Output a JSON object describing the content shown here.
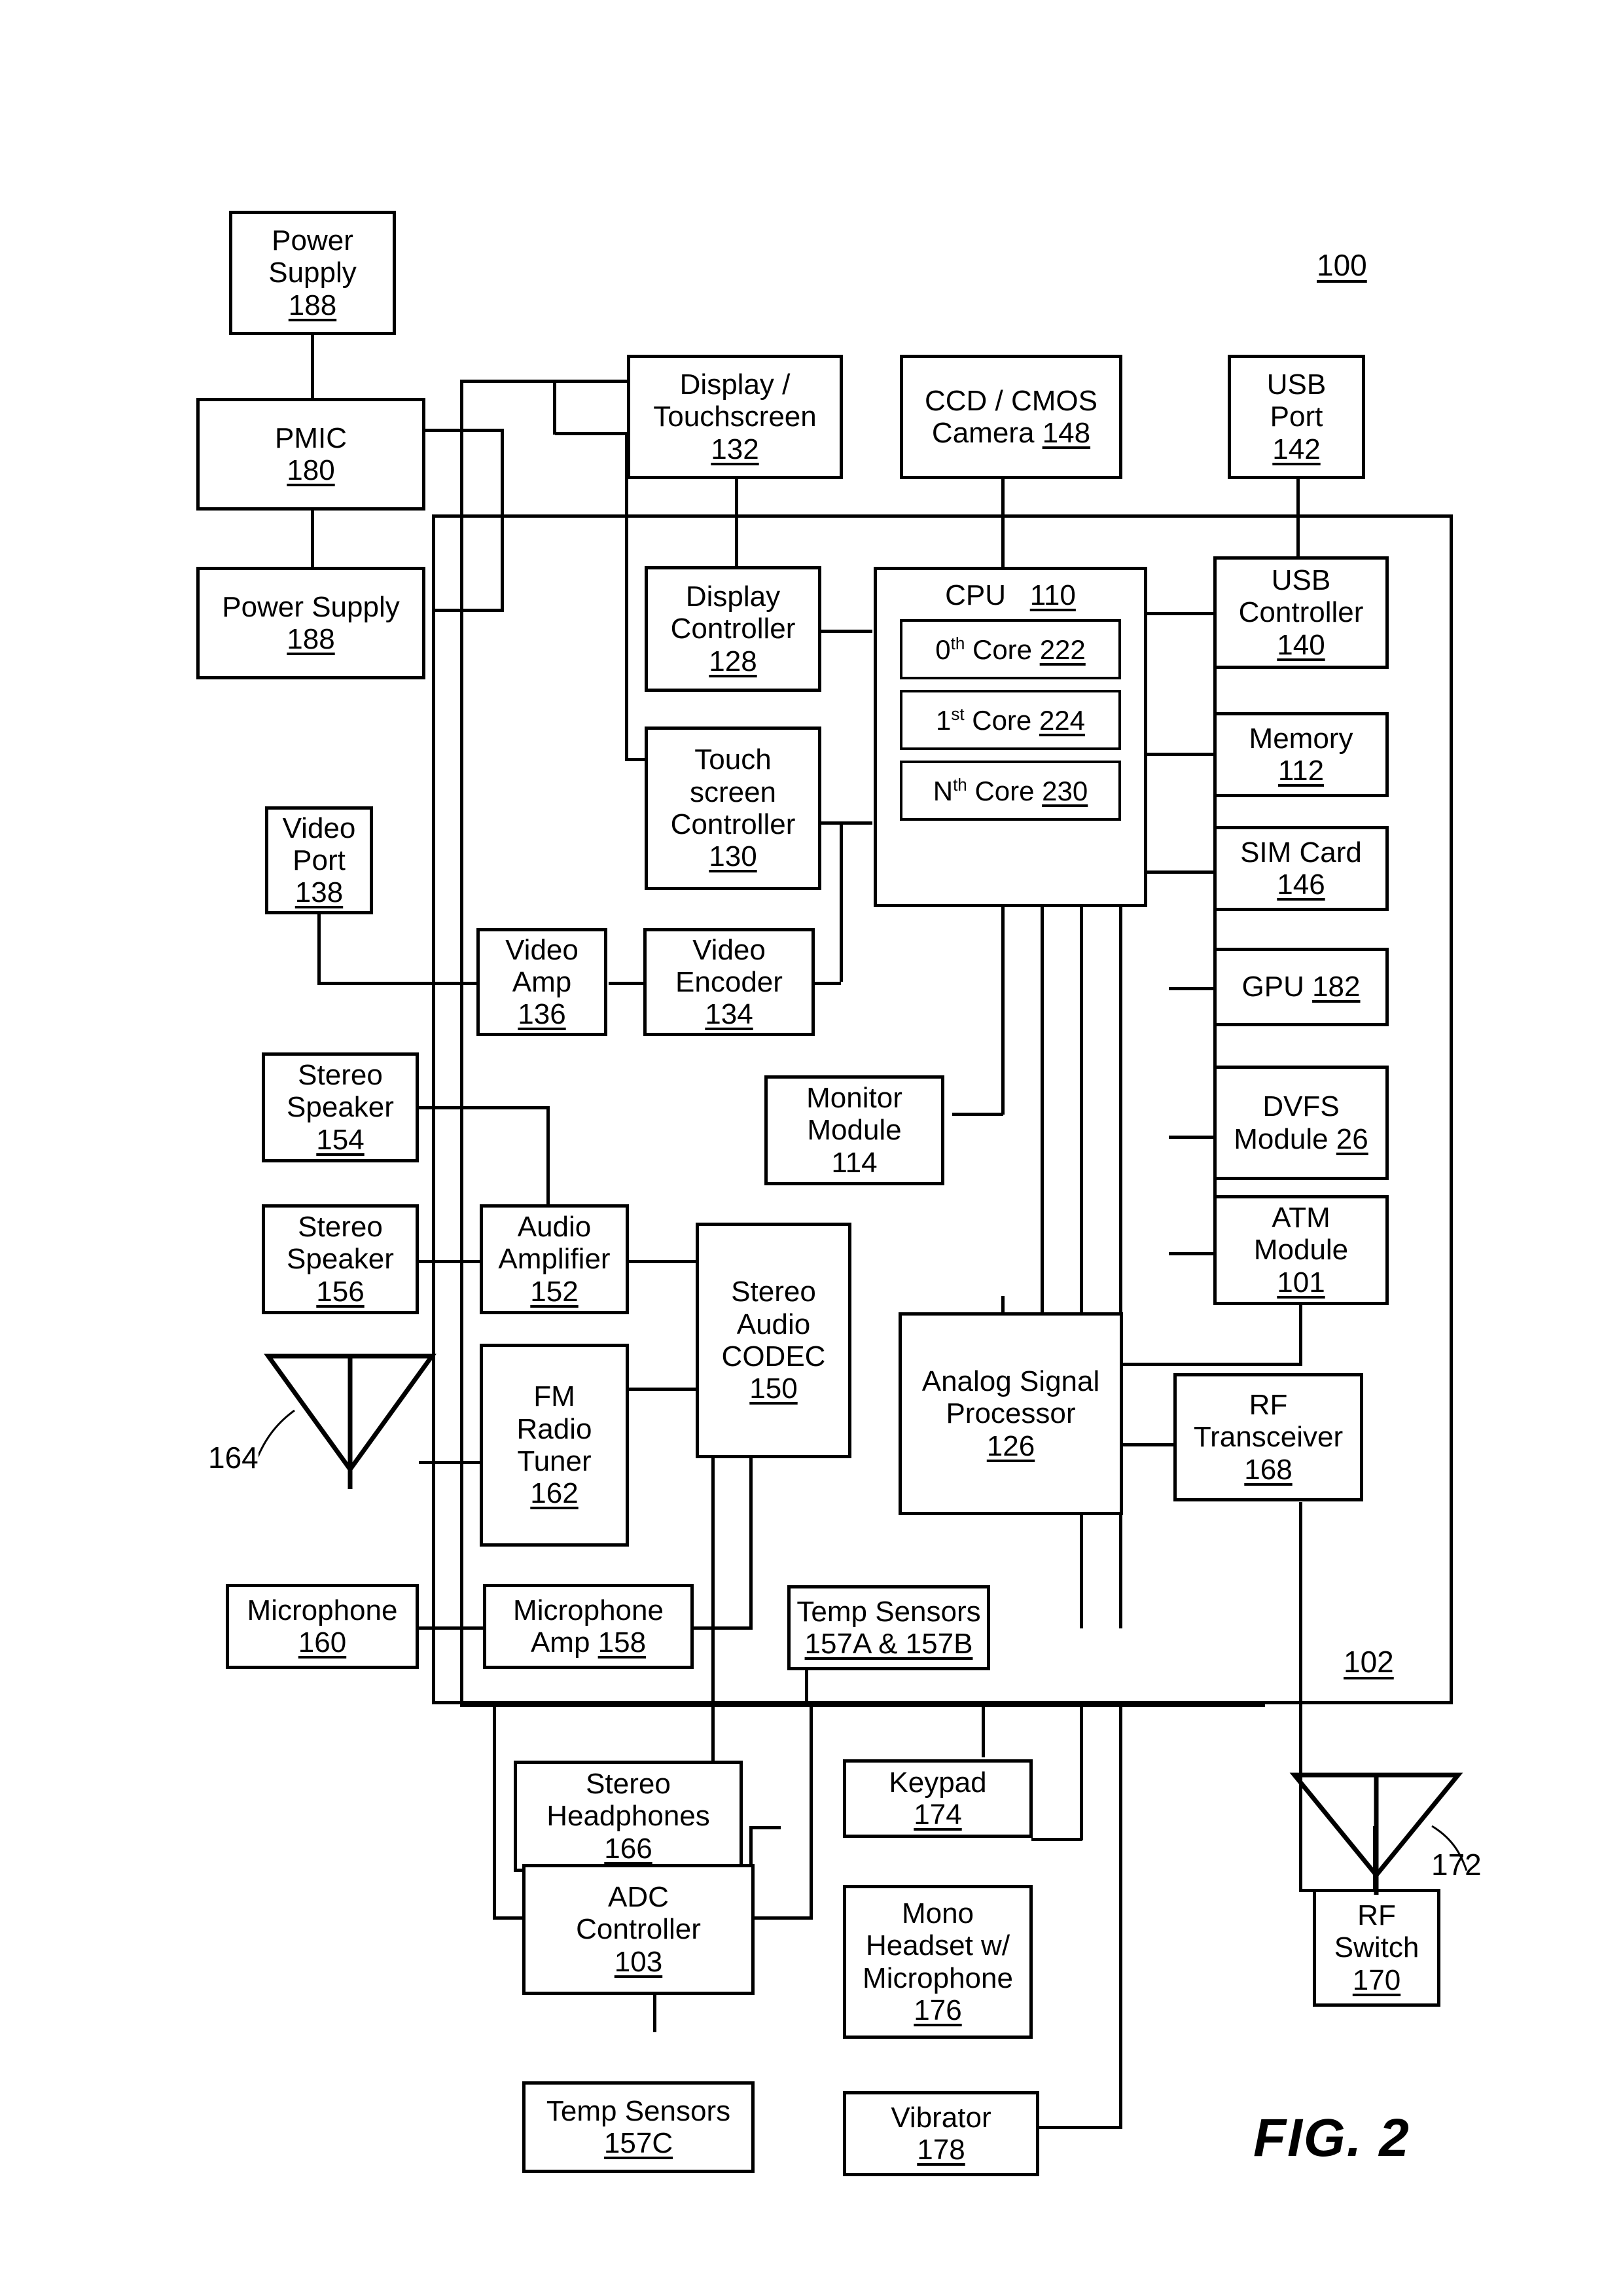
{
  "figure": {
    "caption": "FIG.  2",
    "system_ref": "100",
    "pcb_ref": "102",
    "antenna_fm_ref": "164",
    "antenna_rf_ref": "172"
  },
  "blocks": {
    "power_supply_top": {
      "l1": "Power",
      "l2": "Supply",
      "num": "188"
    },
    "pmic": {
      "l1": "PMIC",
      "num": "180"
    },
    "power_supply_left": {
      "l1": "Power Supply",
      "num": "188"
    },
    "display_touchscreen": {
      "l1": "Display /",
      "l2": "Touchscreen",
      "num": "132"
    },
    "camera": {
      "l1": "CCD / CMOS",
      "l2": "Camera ",
      "num": "148"
    },
    "usb_port": {
      "l1": "USB",
      "l2": "Port",
      "num": "142"
    },
    "display_controller": {
      "l1": "Display",
      "l2": "Controller",
      "num": "128"
    },
    "cpu": {
      "l1": "CPU",
      "num": "110"
    },
    "core0": {
      "pre": "0",
      "sup": "th",
      "mid": " Core ",
      "num": "222"
    },
    "core1": {
      "pre": "1",
      "sup": "st",
      "mid": " Core ",
      "num": "224"
    },
    "coreN": {
      "pre": "N",
      "sup": "th",
      "mid": " Core ",
      "num": "230"
    },
    "usb_controller": {
      "l1": "USB",
      "l2": "Controller",
      "num": "140"
    },
    "touchscreen_controller": {
      "l1": "Touch",
      "l2": "screen",
      "l3": "Controller",
      "num": "130"
    },
    "memory": {
      "l1": "Memory",
      "num": "112"
    },
    "sim_card": {
      "l1": "SIM Card",
      "num": "146"
    },
    "video_port": {
      "l1": "Video",
      "l2": "Port",
      "num": "138"
    },
    "video_amp": {
      "l1": "Video",
      "l2": "Amp",
      "num": "136"
    },
    "video_encoder": {
      "l1": "Video",
      "l2": "Encoder",
      "num": "134"
    },
    "gpu": {
      "l1": "GPU ",
      "num": "182"
    },
    "stereo_speaker_154": {
      "l1": "Stereo",
      "l2": "Speaker",
      "num": "154"
    },
    "monitor_module": {
      "l1": "Monitor",
      "l2": "Module",
      "num": "114"
    },
    "dvfs_module": {
      "l1": "DVFS",
      "l2": "Module ",
      "num": "26"
    },
    "stereo_speaker_156": {
      "l1": "Stereo",
      "l2": "Speaker",
      "num": "156"
    },
    "audio_amplifier": {
      "l1": "Audio",
      "l2": "Amplifier",
      "num": "152"
    },
    "stereo_audio_codec": {
      "l1": "Stereo",
      "l2": "Audio",
      "l3": "CODEC",
      "num": "150"
    },
    "atm_module": {
      "l1": "ATM",
      "l2": "Module",
      "num": "101"
    },
    "fm_radio_tuner": {
      "l1": "FM",
      "l2": "Radio",
      "l3": "Tuner",
      "num": "162"
    },
    "analog_signal_processor": {
      "l1": "Analog Signal",
      "l2": "Processor",
      "num": "126"
    },
    "rf_transceiver": {
      "l1": "RF",
      "l2": "Transceiver",
      "num": "168"
    },
    "microphone": {
      "l1": "Microphone",
      "num": "160"
    },
    "microphone_amp": {
      "l1": "Microphone",
      "l2": "Amp ",
      "num": "158"
    },
    "temp_sensors_ab": {
      "l1": "Temp Sensors",
      "num": "157A & 157B"
    },
    "stereo_headphones": {
      "l1": "Stereo",
      "l2": "Headphones",
      "num": "166"
    },
    "keypad": {
      "l1": "Keypad",
      "num": "174"
    },
    "rf_switch": {
      "l1": "RF",
      "l2": "Switch",
      "num": "170"
    },
    "adc_controller": {
      "l1": "ADC",
      "l2": "Controller",
      "num": "103"
    },
    "mono_headset": {
      "l1": "Mono",
      "l2": "Headset w/",
      "l3": "Microphone",
      "num": "176"
    },
    "temp_sensors_c": {
      "l1": "Temp Sensors",
      "num": "157C"
    },
    "vibrator": {
      "l1": "Vibrator",
      "num": "178"
    }
  }
}
